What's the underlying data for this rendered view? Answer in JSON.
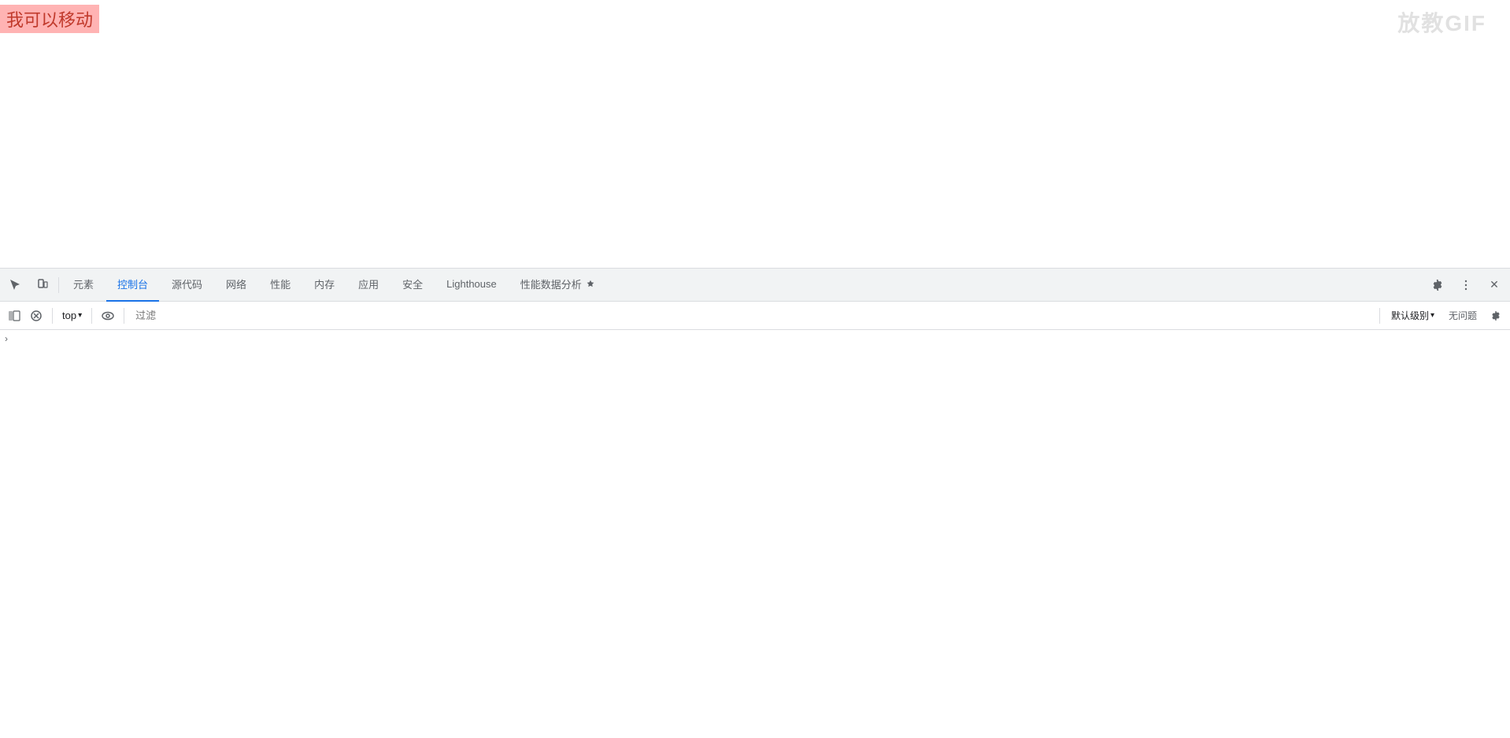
{
  "browser": {
    "highlight_text": "我可以移动",
    "watermark": "放教GIF"
  },
  "devtools": {
    "tabs": [
      {
        "id": "elements",
        "label": "元素",
        "active": false
      },
      {
        "id": "console",
        "label": "控制台",
        "active": true
      },
      {
        "id": "sources",
        "label": "源代码",
        "active": false
      },
      {
        "id": "network",
        "label": "网络",
        "active": false
      },
      {
        "id": "performance",
        "label": "性能",
        "active": false
      },
      {
        "id": "memory",
        "label": "内存",
        "active": false
      },
      {
        "id": "application",
        "label": "应用",
        "active": false
      },
      {
        "id": "security",
        "label": "安全",
        "active": false
      },
      {
        "id": "lighthouse",
        "label": "Lighthouse",
        "active": false
      },
      {
        "id": "perf-insights",
        "label": "性能数据分析",
        "active": false
      }
    ],
    "toolbar_icons": {
      "inspect": "⊡",
      "device": "⬜"
    },
    "right_icons": {
      "settings": "⚙",
      "more": "⋮",
      "close": "✕"
    }
  },
  "console": {
    "context_selector": "top",
    "context_arrow": "▾",
    "filter_placeholder": "过滤",
    "level_label": "默认级别",
    "level_arrow": "▾",
    "no_issues": "无问题",
    "expand_icon": "›"
  }
}
